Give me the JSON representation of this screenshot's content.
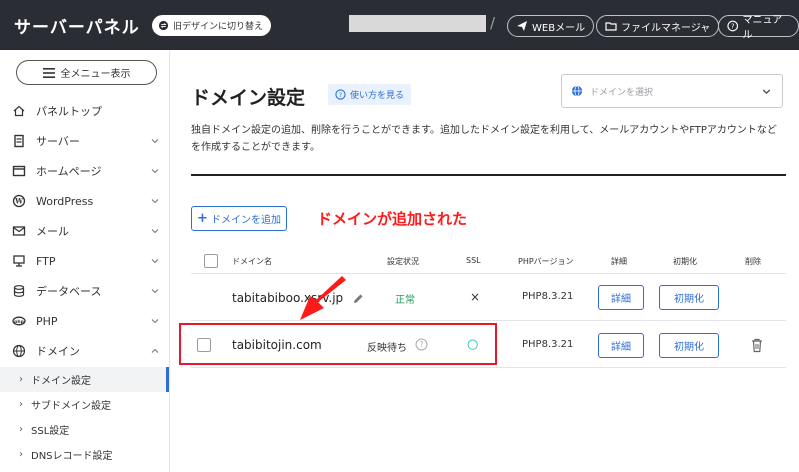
{
  "header": {
    "brand": "サーバーパネル",
    "old_design_label": "旧デザインに切り替え",
    "buttons": {
      "webmail": "WEBメール",
      "file_manager": "ファイルマネージャ",
      "manual": "マニュアル"
    },
    "separator": "/"
  },
  "sidebar": {
    "menu_all_label": "全メニュー表示",
    "items": [
      {
        "label": "パネルトップ",
        "icon": "home-icon"
      },
      {
        "label": "サーバー",
        "icon": "server-icon"
      },
      {
        "label": "ホームページ",
        "icon": "browser-window-icon"
      },
      {
        "label": "WordPress",
        "icon": "wordpress-icon"
      },
      {
        "label": "メール",
        "icon": "envelope-icon"
      },
      {
        "label": "FTP",
        "icon": "monitor-icon"
      },
      {
        "label": "データベース",
        "icon": "database-icon"
      },
      {
        "label": "PHP",
        "icon": "php-icon"
      },
      {
        "label": "ドメイン",
        "icon": "globe-icon"
      }
    ],
    "sub_items": [
      {
        "label": "ドメイン設定",
        "active": true
      },
      {
        "label": "サブドメイン設定",
        "active": false
      },
      {
        "label": "SSL設定",
        "active": false
      },
      {
        "label": "DNSレコード設定",
        "active": false
      }
    ]
  },
  "main": {
    "title": "ドメイン設定",
    "help_label": "使い方を見る",
    "domain_select_placeholder": "ドメインを選択",
    "description": "独自ドメイン設定の追加、削除を行うことができます。追加したドメイン設定を利用して、メールアカウントやFTPアカウントなどを作成することができます。",
    "add_button_label": "ドメインを追加",
    "annotation": "ドメインが追加された",
    "table": {
      "headers": [
        "ドメイン名",
        "設定状況",
        "SSL",
        "PHPバージョン",
        "詳細",
        "初期化",
        "削除"
      ],
      "rows": [
        {
          "domain": "tabitabiboo.xsrv.jp",
          "status": "正常",
          "ssl": "×",
          "php": "PHP8.3.21",
          "detail": "詳細",
          "init": "初期化"
        },
        {
          "domain": "tabibitojin.com",
          "status": "反映待ち",
          "ssl": "○",
          "php": "PHP8.3.21",
          "detail": "詳細",
          "init": "初期化"
        }
      ]
    }
  },
  "colors": {
    "topbar": "#2b2d35",
    "accent": "#2d6fd6",
    "ok": "#1e9c54",
    "annotation_red": "#ff1a1a",
    "ssl_pending": "#1fb5a3"
  }
}
